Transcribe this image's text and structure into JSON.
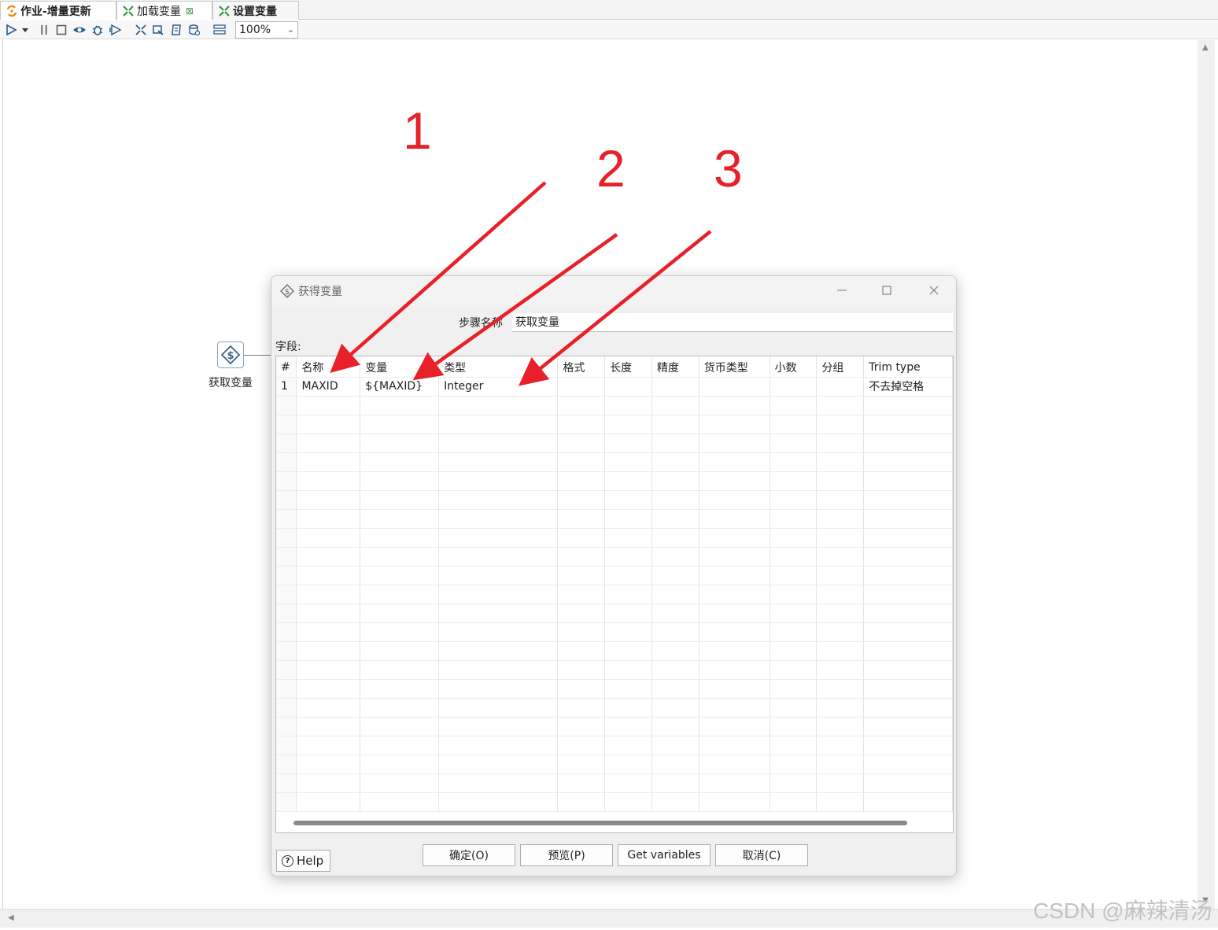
{
  "tabs": [
    {
      "label": "作业-增量更新",
      "active": true
    },
    {
      "label": "加载变量",
      "close": "⊠"
    },
    {
      "label": "设置变量"
    }
  ],
  "toolbar": {
    "zoom": "100%"
  },
  "canvas": {
    "step_label": "获取变量"
  },
  "dialog": {
    "title": "获得变量",
    "step_name_label": "步骤名称",
    "step_name_value": "获取变量",
    "fields_label": "字段:",
    "columns": [
      "#",
      "名称",
      "变量",
      "类型",
      "格式",
      "长度",
      "精度",
      "货币类型",
      "小数",
      "分组",
      "Trim type"
    ],
    "rows": [
      [
        "1",
        "MAXID",
        "${MAXID}",
        "Integer",
        "",
        "",
        "",
        "",
        "",
        "",
        "不去掉空格"
      ]
    ],
    "buttons": {
      "help": "Help",
      "ok": "确定(O)",
      "preview": "预览(P)",
      "get_variables": "Get variables",
      "cancel": "取消(C)"
    }
  },
  "annotations": {
    "n1": "1",
    "n2": "2",
    "n3": "3",
    "color": "#e8202a"
  },
  "watermark": "CSDN @麻辣清汤"
}
